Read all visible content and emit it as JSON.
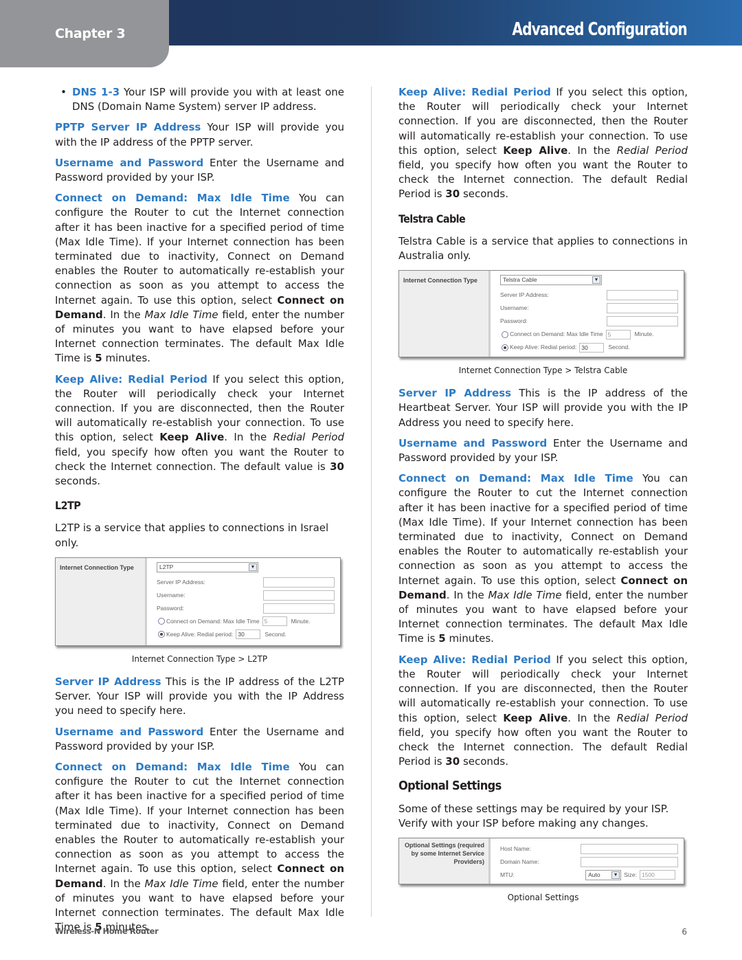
{
  "header": {
    "chapter": "Chapter 3",
    "title": "Advanced Configuration",
    "colors": {
      "band": "#1e335a",
      "band_end": "#2a6db0",
      "tab": "#939598",
      "term": "#2d7bc4"
    }
  },
  "left_column": {
    "dns_bullet": {
      "term": "DNS 1-3",
      "text": " Your ISP will provide you with at least one DNS (Domain Name System) server IP address."
    },
    "pptp_server": {
      "term": "PPTP Server IP Address",
      "text": " Your ISP will provide you with the IP address of the PPTP server."
    },
    "username_password": {
      "term": "Username and Password",
      "text": " Enter the Username and Password provided by your ISP."
    },
    "connect_on_demand": {
      "term": "Connect on Demand: Max Idle Time",
      "text1": " You can configure the Router to cut the Internet connection after it has been inactive for a specified period of time (Max Idle Time). If your Internet connection has been terminated due to inactivity, Connect on Demand enables the Router to automatically re-establish your connection as soon as you attempt to access the Internet again. To use this option, select ",
      "bold1": "Connect on Demand",
      "text2": ". In the ",
      "italic1": "Max Idle Time",
      "text3": " field, enter the number of minutes you want to have elapsed before your Internet connection terminates. The default Max Idle Time is ",
      "bold2": "5",
      "text4": " minutes."
    },
    "keep_alive": {
      "term": "Keep Alive: Redial Period",
      "text1": " If you select this option, the Router will periodically check your Internet connection. If you are disconnected, then the Router will automatically re-establish your connection. To use this option, select ",
      "bold1": "Keep Alive",
      "text2": ". In the ",
      "italic1": "Redial Period",
      "text3": " field, you specify how often you want the Router to check the Internet connection. The default value is ",
      "bold2": "30",
      "text4": " seconds."
    },
    "l2tp_heading": "L2TP",
    "l2tp_intro": "L2TP is a service that applies to connections in Israel only.",
    "l2tp_figure": {
      "side_label": "Internet Connection Type",
      "selected": "L2TP",
      "server_ip_label": "Server IP Address:",
      "username_label": "Username:",
      "password_label": "Password:",
      "connect_on_demand_label": "Connect on Demand: Max Idle Time",
      "max_idle_value": "5",
      "minute_label": "Minute.",
      "keep_alive_label": "Keep Alive: Redial period:",
      "redial_value": "30",
      "second_label": "Second.",
      "caption": "Internet Connection Type > L2TP"
    },
    "server_ip": {
      "term": "Server IP Address",
      "text": " This is the IP address of the L2TP Server. Your ISP will provide you with the IP Address you need to specify here."
    },
    "username_password_2": {
      "term": "Username and Password",
      "text": " Enter the Username and Password provided by your ISP."
    },
    "connect_on_demand_2": {
      "term": "Connect on Demand: Max Idle Time",
      "text1": " You can configure the Router to cut the Internet connection after it has been inactive for a specified period of time (Max Idle Time). If your Internet connection has been terminated due to inactivity, Connect on Demand enables the Router to automatically re-establish your connection as soon as you attempt to access the Internet again. To use this option, select ",
      "bold1": "Connect on Demand",
      "text2": ". In the ",
      "italic1": "Max Idle Time",
      "text3": " field, enter the number of minutes you want to have elapsed before your Internet connection terminates. The default Max Idle Time is ",
      "bold2": "5",
      "text4": " minutes."
    }
  },
  "right_column": {
    "keep_alive": {
      "term": "Keep Alive: Redial Period",
      "text1": " If you select this option, the Router will periodically check your Internet connection. If you are disconnected, then the Router will automatically re-establish your connection. To use this option, select ",
      "bold1": "Keep Alive",
      "text2": ". In the ",
      "italic1": "Redial Period",
      "text3": " field, you specify how often you want the Router to check the Internet connection. The default Redial Period is ",
      "bold2": "30",
      "text4": " seconds."
    },
    "telstra_heading": "Telstra Cable",
    "telstra_intro": "Telstra Cable is a service that applies to connections in Australia only.",
    "telstra_figure": {
      "side_label": "Internet Connection Type",
      "selected": "Telstra Cable",
      "server_ip_label": "Server IP Address:",
      "username_label": "Username:",
      "password_label": "Password:",
      "connect_on_demand_label": "Connect on Demand: Max Idle Time",
      "max_idle_value": "5",
      "minute_label": "Minute.",
      "keep_alive_label": "Keep Alive: Redial period:",
      "redial_value": "30",
      "second_label": "Second.",
      "caption": "Internet Connection Type > Telstra Cable"
    },
    "server_ip": {
      "term": "Server IP Address",
      "text": " This is the IP address of the Heartbeat Server. Your ISP will provide you with the IP Address you need to specify here."
    },
    "username_password": {
      "term": "Username and Password",
      "text": " Enter the Username and Password provided by your ISP."
    },
    "connect_on_demand": {
      "term": "Connect on Demand: Max Idle Time",
      "text1": " You can configure the Router to cut the Internet connection after it has been inactive for a specified period of time (Max Idle Time). If your Internet connection has been terminated due to inactivity, Connect on Demand enables the Router to automatically re-establish your connection as soon as you attempt to access the Internet again. To use this option, select ",
      "bold1": "Connect on Demand",
      "text2": ". In the ",
      "italic1": "Max Idle Time",
      "text3": " field, enter the number of minutes you want to have elapsed before your Internet connection terminates. The default Max Idle Time is ",
      "bold2": "5",
      "text4": " minutes."
    },
    "keep_alive_2": {
      "term": "Keep Alive: Redial Period",
      "text1": " If you select this option, the Router will periodically check your Internet connection. If you are disconnected, then the Router will automatically re-establish your connection. To use this option, select ",
      "bold1": "Keep Alive",
      "text2": ". In the ",
      "italic1": "Redial Period",
      "text3": " field, you specify how often you want the Router to check the Internet connection. The default Redial Period is ",
      "bold2": "30",
      "text4": " seconds."
    },
    "optional_heading": "Optional Settings",
    "optional_intro": "Some of these settings may be required by your ISP. Verify with your ISP before making any changes.",
    "optional_figure": {
      "side_label": "Optional Settings (required by some Internet Service Providers)",
      "host_name_label": "Host Name:",
      "domain_name_label": "Domain Name:",
      "mtu_label": "MTU:",
      "mtu_selected": "Auto",
      "size_label": "Size:",
      "size_value": "1500",
      "caption": "Optional Settings"
    }
  },
  "footer": {
    "product": "Wireless-N Home Router",
    "page_number": "6"
  }
}
